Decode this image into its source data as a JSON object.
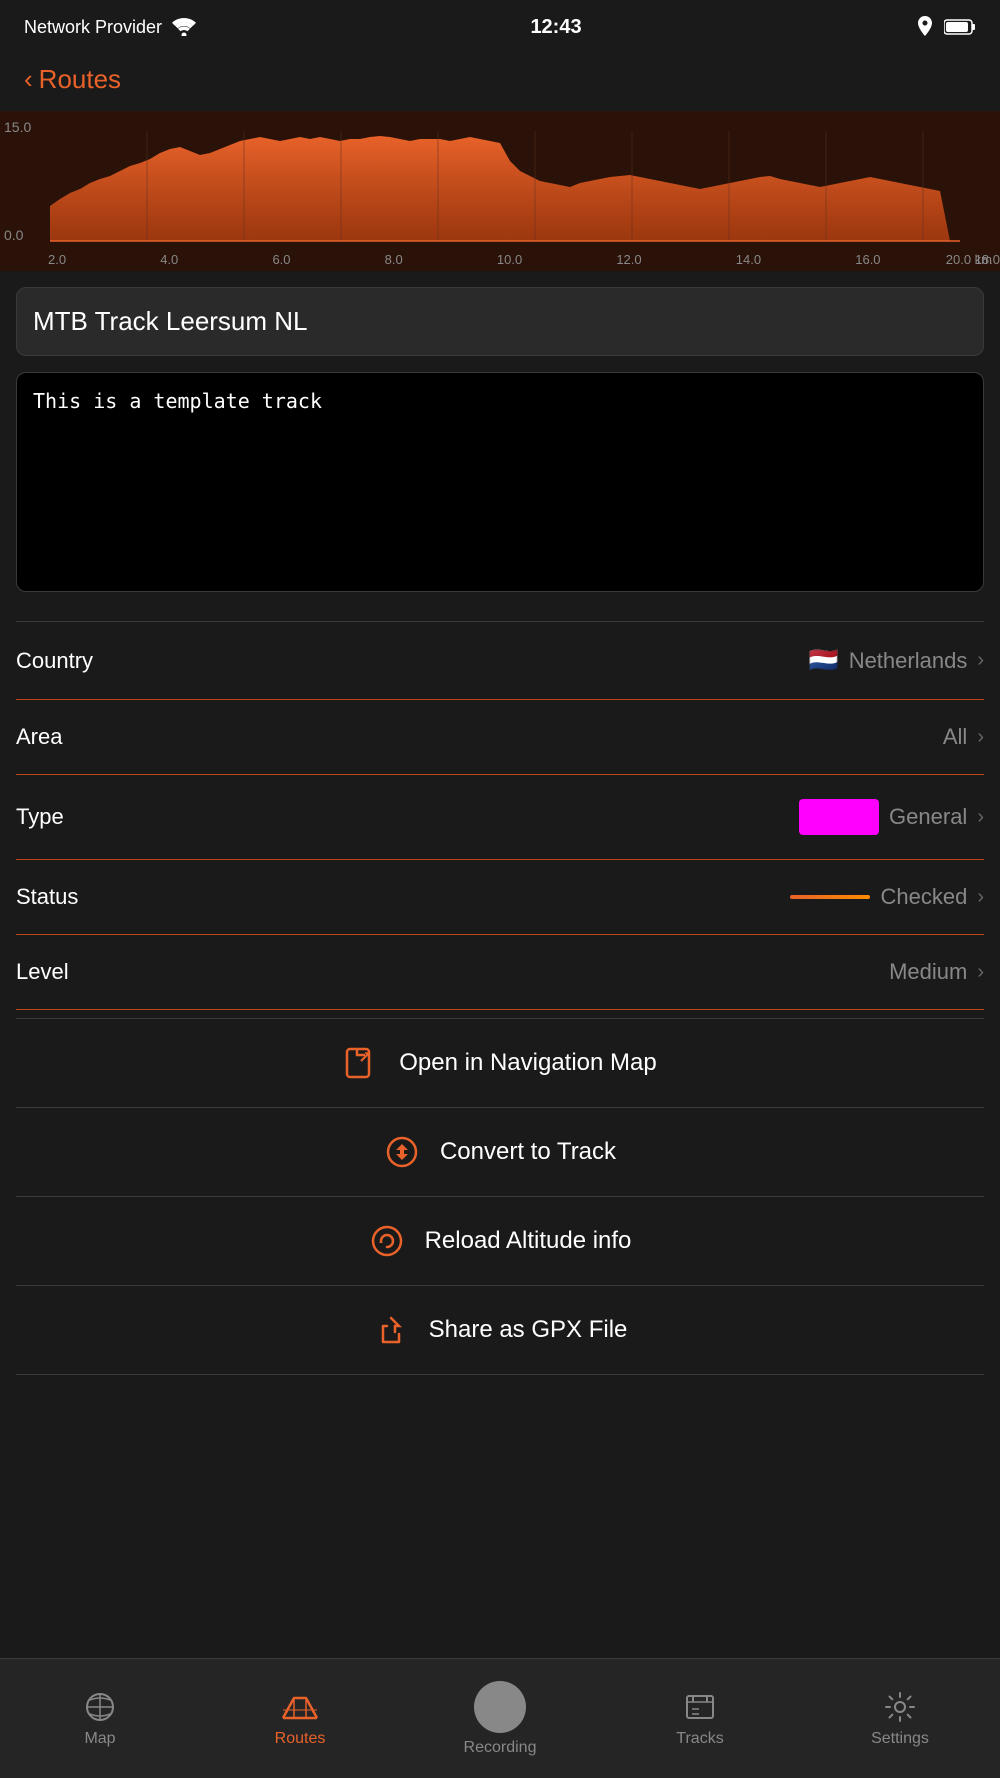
{
  "statusBar": {
    "carrier": "Network Provider",
    "time": "12:43"
  },
  "navBar": {
    "backLabel": "Routes"
  },
  "chart": {
    "yMax": "15.0",
    "yMin": "0.0",
    "xLabels": [
      "2.0",
      "4.0",
      "6.0",
      "8.0",
      "10.0",
      "12.0",
      "14.0",
      "16.0",
      "18.0"
    ],
    "xMax": "20.0",
    "unit": "km"
  },
  "trackName": "MTB Track Leersum NL",
  "description": "This is a template track",
  "settings": {
    "country": {
      "label": "Country",
      "value": "Netherlands",
      "flag": "🇳🇱"
    },
    "area": {
      "label": "Area",
      "value": "All"
    },
    "type": {
      "label": "Type",
      "value": "General",
      "color": "#ff00ff"
    },
    "status": {
      "label": "Status",
      "value": "Checked"
    },
    "level": {
      "label": "Level",
      "value": "Medium"
    }
  },
  "actions": {
    "openMap": "Open in Navigation Map",
    "convertTrack": "Convert to Track",
    "reloadAltitude": "Reload Altitude info",
    "shareGPX": "Share as GPX File"
  },
  "tabBar": {
    "items": [
      {
        "id": "map",
        "label": "Map",
        "active": false
      },
      {
        "id": "routes",
        "label": "Routes",
        "active": true
      },
      {
        "id": "recording",
        "label": "Recording",
        "active": false
      },
      {
        "id": "tracks",
        "label": "Tracks",
        "active": false
      },
      {
        "id": "settings",
        "label": "Settings",
        "active": false
      }
    ]
  }
}
